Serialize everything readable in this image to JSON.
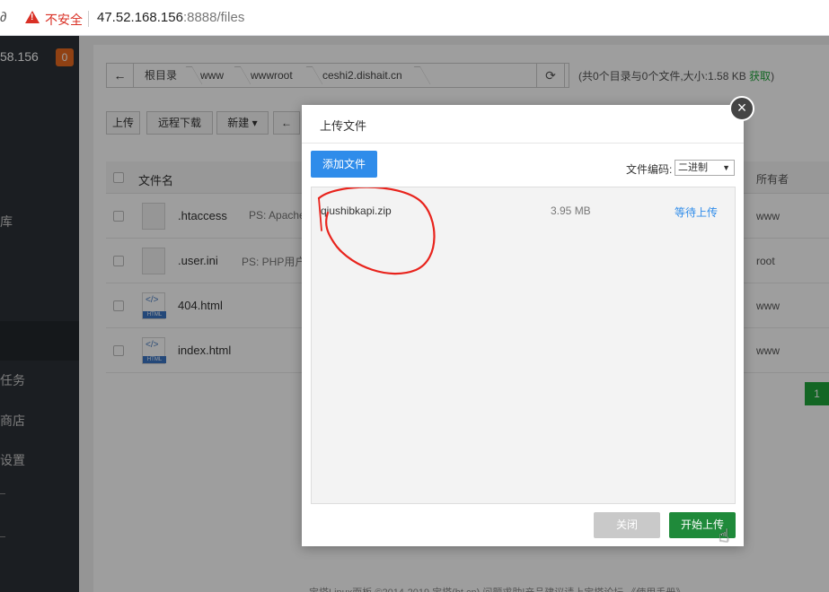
{
  "browser": {
    "lead_glyph": "∂",
    "security_label": "不安全",
    "url_host": "47.52.168.156",
    "url_rest": ":8888/files"
  },
  "sidebar": {
    "ip": "58.156",
    "badge": "0",
    "items": [
      "库",
      "任务",
      "商店",
      "设置"
    ]
  },
  "pathbar": {
    "crumbs": [
      "根目录",
      "www",
      "wwwroot",
      "ceshi2.dishait.cn"
    ],
    "summary_text": "(共0个目录与0个文件,大小:1.58 KB ",
    "summary_link": "获取",
    "summary_end": ")"
  },
  "toolbar": {
    "upload": "上传",
    "remote_download": "远程下载",
    "new": "新建",
    "back": "←"
  },
  "table": {
    "col_filename": "文件名",
    "col_owner": "所有者",
    "rows": [
      {
        "name": ".htaccess",
        "ps": "PS: Apache",
        "owner": "www",
        "type": "plain"
      },
      {
        "name": ".user.ini",
        "ps": "PS: PHP用户",
        "owner": "root",
        "type": "plain"
      },
      {
        "name": "404.html",
        "ps": "",
        "owner": "www",
        "type": "html"
      },
      {
        "name": "index.html",
        "ps": "",
        "owner": "www",
        "type": "html"
      }
    ],
    "page": "1"
  },
  "footer": {
    "text": "宝塔Linux面板 ©2014-2019 宝塔(bt.cn)  问题求助|产品建议请上宝塔论坛  《使用手册》"
  },
  "modal": {
    "title": "上传文件",
    "add_file": "添加文件",
    "encoding_label": "文件编码:",
    "encoding_value": "二进制",
    "file": {
      "name": "qiushibkapi.zip",
      "size": "3.95 MB",
      "status": "等待上传"
    },
    "close_label": "关闭",
    "start_label": "开始上传"
  },
  "colors": {
    "accent_green": "#20a53a",
    "accent_blue": "#2f8cea",
    "annotation_red": "#e8231c"
  }
}
